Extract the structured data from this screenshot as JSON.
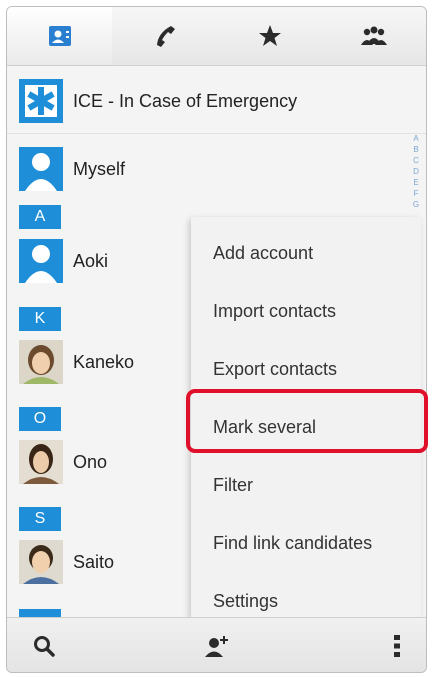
{
  "tabs": [
    {
      "icon": "contacts-icon",
      "selected": true
    },
    {
      "icon": "phone-icon",
      "selected": false
    },
    {
      "icon": "star-icon",
      "selected": false
    },
    {
      "icon": "groups-icon",
      "selected": false
    }
  ],
  "contacts": [
    {
      "name": "ICE - In Case of Emergency",
      "avatar": "ice-icon"
    },
    {
      "name": "Myself",
      "avatar": "person-avatar"
    }
  ],
  "sections": [
    {
      "letter": "A",
      "name": "Aoki",
      "avatar": "person-avatar"
    },
    {
      "letter": "K",
      "name": "Kaneko",
      "avatar": "photo-avatar"
    },
    {
      "letter": "O",
      "name": "Ono",
      "avatar": "photo-avatar"
    },
    {
      "letter": "S",
      "name": "Saito",
      "avatar": "photo-avatar"
    }
  ],
  "index_letters": [
    "A",
    "B",
    "C",
    "D",
    "E",
    "F",
    "G"
  ],
  "menu": {
    "items": [
      "Add account",
      "Import contacts",
      "Export contacts",
      "Mark several",
      "Filter",
      "Find link candidates",
      "Settings"
    ],
    "highlighted": "Mark several"
  },
  "bottom_bar": {
    "search_icon": "search-icon",
    "add_contact_icon": "add-contact-icon",
    "more_icon": "overflow-menu-icon"
  },
  "colors": {
    "section_header": "#1e8ed8",
    "highlight_border": "#e0102a",
    "tab_icon_selected": "#2a7fd0",
    "icon_dark": "#2b2b2b"
  }
}
